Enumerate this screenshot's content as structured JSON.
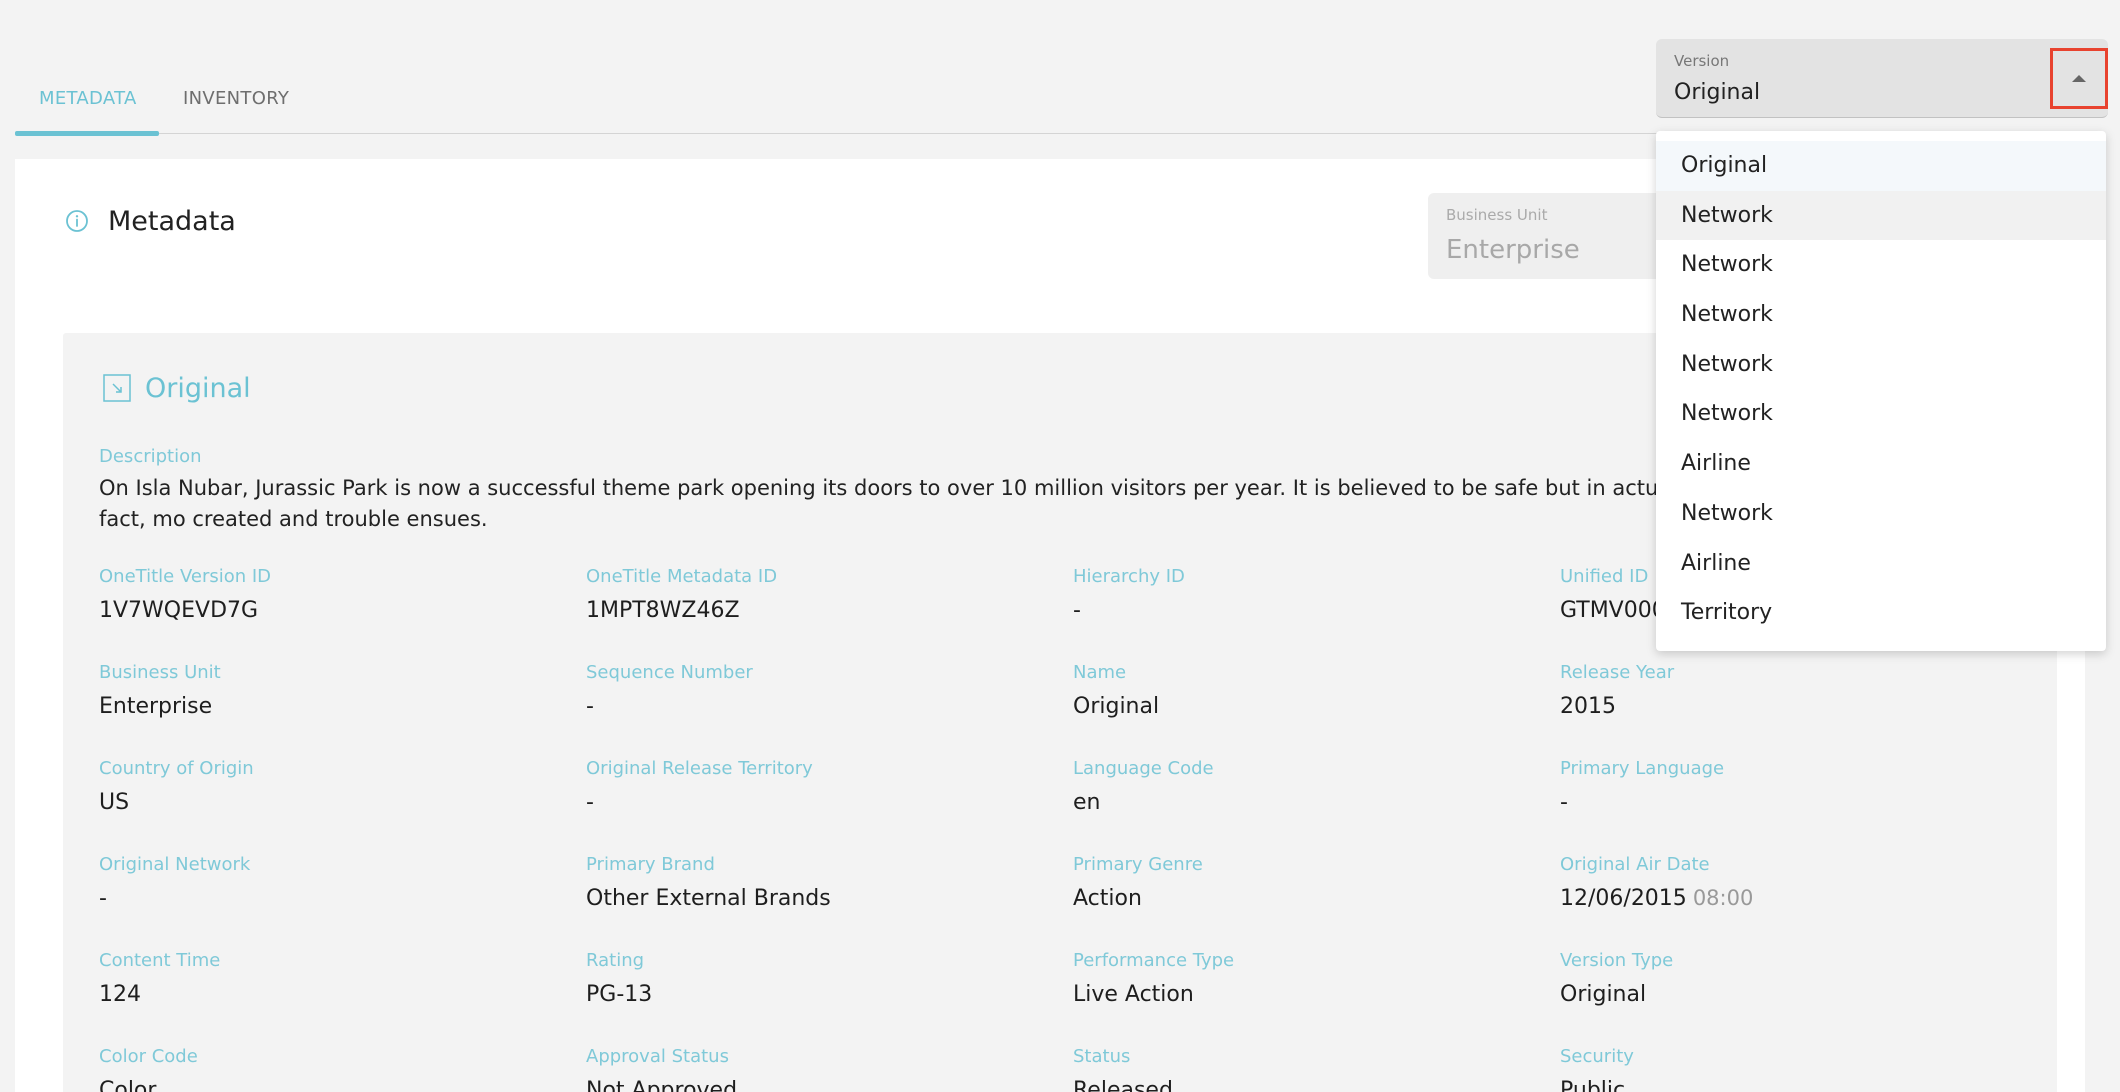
{
  "tabs": [
    {
      "label": "METADATA",
      "active": true
    },
    {
      "label": "INVENTORY",
      "active": false
    }
  ],
  "version_select": {
    "label": "Version",
    "value": "Original",
    "options": [
      "Original",
      "Network",
      "Network",
      "Network",
      "Network",
      "Network",
      "Airline",
      "Network",
      "Airline",
      "Territory"
    ],
    "selected_index": 0,
    "hover_index": 1
  },
  "card": {
    "title": "Metadata",
    "business_unit": {
      "label": "Business Unit",
      "value": "Enterprise"
    }
  },
  "panel": {
    "title": "Original",
    "description_label": "Description",
    "description": "On Isla Nubar, Jurassic Park is now a successful theme park opening its doors to over 10 million visitors per year. It is believed to be safe but in actual fact, mo created and trouble ensues.",
    "fields": [
      {
        "label": "OneTitle Version ID",
        "value": "1V7WQEVD7G"
      },
      {
        "label": "OneTitle Metadata ID",
        "value": "1MPT8WZ46Z"
      },
      {
        "label": "Hierarchy ID",
        "value": "-"
      },
      {
        "label": "Unified ID",
        "value": "GTMV000"
      },
      {
        "label": "Business Unit",
        "value": "Enterprise"
      },
      {
        "label": "Sequence Number",
        "value": "-"
      },
      {
        "label": "Name",
        "value": "Original"
      },
      {
        "label": "Release Year",
        "value": "2015"
      },
      {
        "label": "Country of Origin",
        "value": "US"
      },
      {
        "label": "Original Release Territory",
        "value": "-"
      },
      {
        "label": "Language Code",
        "value": "en"
      },
      {
        "label": "Primary Language",
        "value": "-"
      },
      {
        "label": "Original Network",
        "value": "-"
      },
      {
        "label": "Primary Brand",
        "value": "Other External Brands"
      },
      {
        "label": "Primary Genre",
        "value": "Action"
      },
      {
        "label": "Original Air Date",
        "value": "12/06/2015",
        "extra": "08:00"
      },
      {
        "label": "Content Time",
        "value": "124"
      },
      {
        "label": "Rating",
        "value": "PG-13"
      },
      {
        "label": "Performance Type",
        "value": "Live Action"
      },
      {
        "label": "Version Type",
        "value": "Original"
      },
      {
        "label": "Color Code",
        "value": "Color"
      },
      {
        "label": "Approval Status",
        "value": "Not Approved"
      },
      {
        "label": "Status",
        "value": "Released"
      },
      {
        "label": "Security",
        "value": "Public"
      }
    ]
  },
  "colors": {
    "accent": "#6bc2d3",
    "highlight_border": "#e8432f",
    "background": "#f3f3f3"
  }
}
